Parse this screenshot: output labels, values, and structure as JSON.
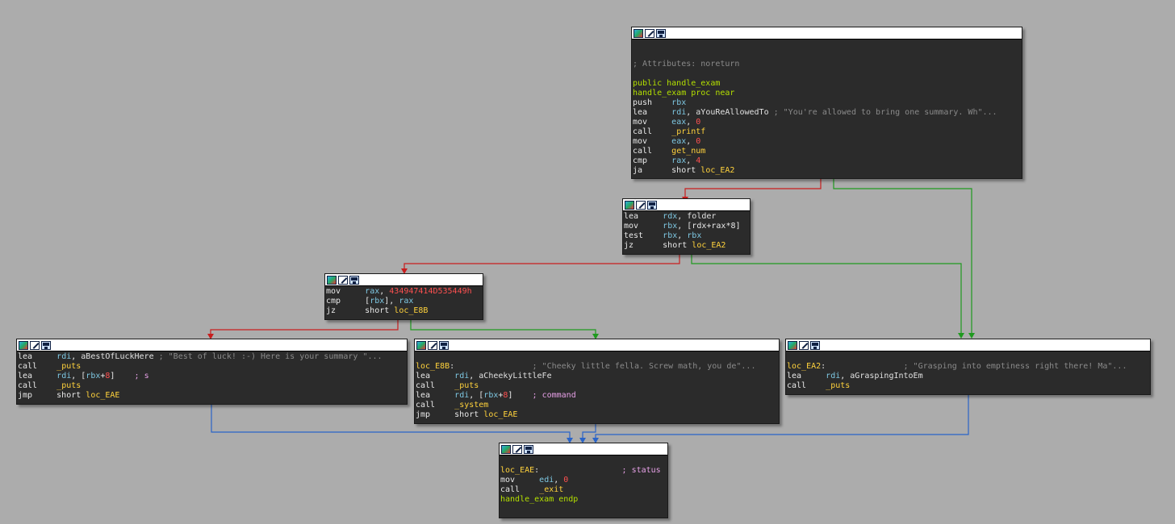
{
  "colors": {
    "background": "#acacac",
    "node_bg": "#2b2b2b",
    "edge_taken": "#1f9a1f",
    "edge_not_taken": "#c81e1e",
    "edge_unconditional": "#2a64c8"
  },
  "node_header_icons": [
    "color-icon",
    "edit-icon",
    "graph-icon"
  ],
  "nodes": {
    "entry": {
      "lines": [
        [],
        [],
        [
          {
            "cls": "c-str",
            "t": "; Attributes: noreturn"
          }
        ],
        [],
        [
          {
            "cls": "c-grn",
            "t": "public handle_exam"
          }
        ],
        [
          {
            "cls": "c-grn",
            "t": "handle_exam proc near"
          }
        ],
        [
          {
            "cls": "c-mn",
            "t": "push    "
          },
          {
            "cls": "c-reg",
            "t": "rbx"
          }
        ],
        [
          {
            "cls": "c-mn",
            "t": "lea     "
          },
          {
            "cls": "c-reg",
            "t": "rdi"
          },
          {
            "cls": "c-mn",
            "t": ", "
          },
          {
            "cls": "c-var",
            "t": "aYouReAllowedTo"
          },
          {
            "cls": "c-str",
            "t": " ; \"You're allowed to bring one summary. Wh\"..."
          }
        ],
        [
          {
            "cls": "c-mn",
            "t": "mov     "
          },
          {
            "cls": "c-reg",
            "t": "eax"
          },
          {
            "cls": "c-mn",
            "t": ", "
          },
          {
            "cls": "c-num",
            "t": "0"
          }
        ],
        [
          {
            "cls": "c-mn",
            "t": "call    "
          },
          {
            "cls": "c-name",
            "t": "_printf"
          }
        ],
        [
          {
            "cls": "c-mn",
            "t": "mov     "
          },
          {
            "cls": "c-reg",
            "t": "eax"
          },
          {
            "cls": "c-mn",
            "t": ", "
          },
          {
            "cls": "c-num",
            "t": "0"
          }
        ],
        [
          {
            "cls": "c-mn",
            "t": "call    "
          },
          {
            "cls": "c-name",
            "t": "get_num"
          }
        ],
        [
          {
            "cls": "c-mn",
            "t": "cmp     "
          },
          {
            "cls": "c-reg",
            "t": "rax"
          },
          {
            "cls": "c-mn",
            "t": ", "
          },
          {
            "cls": "c-num",
            "t": "4"
          }
        ],
        [
          {
            "cls": "c-mn",
            "t": "ja      short "
          },
          {
            "cls": "c-name",
            "t": "loc_EA2"
          }
        ]
      ]
    },
    "folder": {
      "lines": [
        [
          {
            "cls": "c-mn",
            "t": "lea     "
          },
          {
            "cls": "c-reg",
            "t": "rdx"
          },
          {
            "cls": "c-mn",
            "t": ", "
          },
          {
            "cls": "c-var",
            "t": "folder"
          }
        ],
        [
          {
            "cls": "c-mn",
            "t": "mov     "
          },
          {
            "cls": "c-reg",
            "t": "rbx"
          },
          {
            "cls": "c-mn",
            "t": ", [rdx+rax*8]"
          }
        ],
        [
          {
            "cls": "c-mn",
            "t": "test    "
          },
          {
            "cls": "c-reg",
            "t": "rbx"
          },
          {
            "cls": "c-mn",
            "t": ", "
          },
          {
            "cls": "c-reg",
            "t": "rbx"
          }
        ],
        [
          {
            "cls": "c-mn",
            "t": "jz      short "
          },
          {
            "cls": "c-name",
            "t": "loc_EA2"
          }
        ]
      ]
    },
    "cmp": {
      "lines": [
        [
          {
            "cls": "c-mn",
            "t": "mov     "
          },
          {
            "cls": "c-reg",
            "t": "rax"
          },
          {
            "cls": "c-mn",
            "t": ", "
          },
          {
            "cls": "c-num",
            "t": "434947414D535449h"
          }
        ],
        [
          {
            "cls": "c-mn",
            "t": "cmp     "
          },
          {
            "cls": "c-mn",
            "t": "["
          },
          {
            "cls": "c-reg",
            "t": "rbx"
          },
          {
            "cls": "c-mn",
            "t": "], "
          },
          {
            "cls": "c-reg",
            "t": "rax"
          }
        ],
        [
          {
            "cls": "c-mn",
            "t": "jz      short "
          },
          {
            "cls": "c-name",
            "t": "loc_E8B"
          }
        ]
      ]
    },
    "luck": {
      "lines": [
        [
          {
            "cls": "c-mn",
            "t": "lea     "
          },
          {
            "cls": "c-reg",
            "t": "rdi"
          },
          {
            "cls": "c-mn",
            "t": ", "
          },
          {
            "cls": "c-var",
            "t": "aBestOfLuckHere"
          },
          {
            "cls": "c-str",
            "t": " ; \"Best of luck! :-) Here is your summary \"..."
          }
        ],
        [
          {
            "cls": "c-mn",
            "t": "call    "
          },
          {
            "cls": "c-name",
            "t": "_puts"
          }
        ],
        [
          {
            "cls": "c-mn",
            "t": "lea     "
          },
          {
            "cls": "c-reg",
            "t": "rdi"
          },
          {
            "cls": "c-mn",
            "t": ", ["
          },
          {
            "cls": "c-reg",
            "t": "rbx"
          },
          {
            "cls": "c-mn",
            "t": "+"
          },
          {
            "cls": "c-num",
            "t": "8"
          },
          {
            "cls": "c-mn",
            "t": "]    "
          },
          {
            "cls": "c-cmt",
            "t": "; s"
          }
        ],
        [
          {
            "cls": "c-mn",
            "t": "call    "
          },
          {
            "cls": "c-name",
            "t": "_puts"
          }
        ],
        [
          {
            "cls": "c-mn",
            "t": "jmp     short "
          },
          {
            "cls": "c-name",
            "t": "loc_EAE"
          }
        ]
      ]
    },
    "cheeky": {
      "lines": [
        [],
        [
          {
            "cls": "c-name",
            "t": "loc_E8B"
          },
          {
            "cls": "c-mn",
            "t": ":                "
          },
          {
            "cls": "c-str",
            "t": "; \"Cheeky little fella. Screw math, you de\"..."
          }
        ],
        [
          {
            "cls": "c-mn",
            "t": "lea     "
          },
          {
            "cls": "c-reg",
            "t": "rdi"
          },
          {
            "cls": "c-mn",
            "t": ", "
          },
          {
            "cls": "c-var",
            "t": "aCheekyLittleFe"
          }
        ],
        [
          {
            "cls": "c-mn",
            "t": "call    "
          },
          {
            "cls": "c-name",
            "t": "_puts"
          }
        ],
        [
          {
            "cls": "c-mn",
            "t": "lea     "
          },
          {
            "cls": "c-reg",
            "t": "rdi"
          },
          {
            "cls": "c-mn",
            "t": ", ["
          },
          {
            "cls": "c-reg",
            "t": "rbx"
          },
          {
            "cls": "c-mn",
            "t": "+"
          },
          {
            "cls": "c-num",
            "t": "8"
          },
          {
            "cls": "c-mn",
            "t": "]    "
          },
          {
            "cls": "c-cmt",
            "t": "; command"
          }
        ],
        [
          {
            "cls": "c-mn",
            "t": "call    "
          },
          {
            "cls": "c-name",
            "t": "_system"
          }
        ],
        [
          {
            "cls": "c-mn",
            "t": "jmp     short "
          },
          {
            "cls": "c-name",
            "t": "loc_EAE"
          }
        ]
      ]
    },
    "grasp": {
      "lines": [
        [],
        [
          {
            "cls": "c-name",
            "t": "loc_EA2"
          },
          {
            "cls": "c-mn",
            "t": ":                "
          },
          {
            "cls": "c-str",
            "t": "; \"Grasping into emptiness right there! Ma\"..."
          }
        ],
        [
          {
            "cls": "c-mn",
            "t": "lea     "
          },
          {
            "cls": "c-reg",
            "t": "rdi"
          },
          {
            "cls": "c-mn",
            "t": ", "
          },
          {
            "cls": "c-var",
            "t": "aGraspingIntoEm"
          }
        ],
        [
          {
            "cls": "c-mn",
            "t": "call    "
          },
          {
            "cls": "c-name",
            "t": "_puts"
          }
        ]
      ]
    },
    "exit": {
      "lines": [
        [],
        [
          {
            "cls": "c-name",
            "t": "loc_EAE"
          },
          {
            "cls": "c-mn",
            "t": ":                 "
          },
          {
            "cls": "c-cmt",
            "t": "; status"
          }
        ],
        [
          {
            "cls": "c-mn",
            "t": "mov     "
          },
          {
            "cls": "c-reg",
            "t": "edi"
          },
          {
            "cls": "c-mn",
            "t": ", "
          },
          {
            "cls": "c-num",
            "t": "0"
          }
        ],
        [
          {
            "cls": "c-mn",
            "t": "call    "
          },
          {
            "cls": "c-name",
            "t": "_exit"
          }
        ],
        [
          {
            "cls": "c-grn",
            "t": "handle_exam endp"
          }
        ]
      ]
    }
  }
}
